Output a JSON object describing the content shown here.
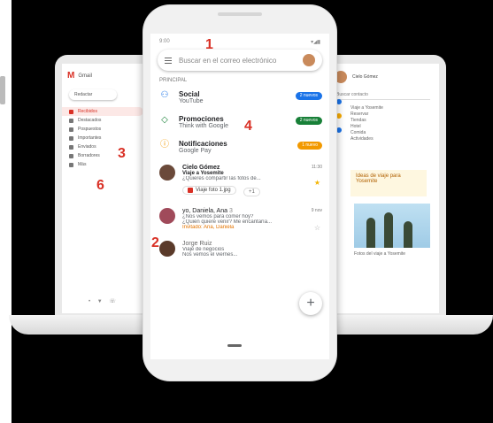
{
  "colors": {
    "accent": "#d93025",
    "social": "#1a73e8",
    "promos": "#188038",
    "notif": "#f29900"
  },
  "annotations": [
    "1",
    "2",
    "3",
    "4",
    "6"
  ],
  "left_gmail": {
    "app_name": "Gmail",
    "compose": "Redactar",
    "items": [
      "Recibidos",
      "Destacados",
      "Pospuestos",
      "Importantes",
      "Enviados",
      "Borradores",
      "Más"
    ]
  },
  "phone": {
    "time": "9:00",
    "search_placeholder": "Buscar en el correo electrónico",
    "section_label": "PRINCIPAL",
    "categories": [
      {
        "title": "Social",
        "sub": "YouTube",
        "pill": "2 nuevos"
      },
      {
        "title": "Promociones",
        "sub": "Think with Google",
        "pill": "2 nuevos"
      },
      {
        "title": "Notificaciones",
        "sub": "Google Pay",
        "pill": "1 nuevo"
      }
    ],
    "emails": [
      {
        "from": "Cielo Gómez",
        "subject": "Viaje a Yosemite",
        "snippet": "¿Quieres compartir las fotos de...",
        "time": "11:30",
        "attachment": "Viaje foto 1.jpg",
        "more": "+1"
      },
      {
        "from": "yo, Daniela, Ana",
        "count": "3",
        "subject": "",
        "snippet": "¿Nos vemos para comer hoy?",
        "snippet2": "¿Quién quiere venir? Me encantaría...",
        "tag": "Invitado: Ana, Daniela",
        "time": "9 nov"
      },
      {
        "from": "Jorge Ruiz",
        "subject": "Viaje de negocios",
        "snippet": "Nos vemos el viernes...",
        "time": ""
      }
    ],
    "fab": "+"
  },
  "right_panel": {
    "name": "Cielo Gómez",
    "search": "Buscar contacto",
    "list": [
      "Viaje a Yosemite",
      "Reservar",
      "Tiendas",
      "Hotel",
      "Comida",
      "Actividades"
    ],
    "note": "Ideas de viaje para Yosemite",
    "caption": "Fotos del viaje a Yosemite"
  }
}
